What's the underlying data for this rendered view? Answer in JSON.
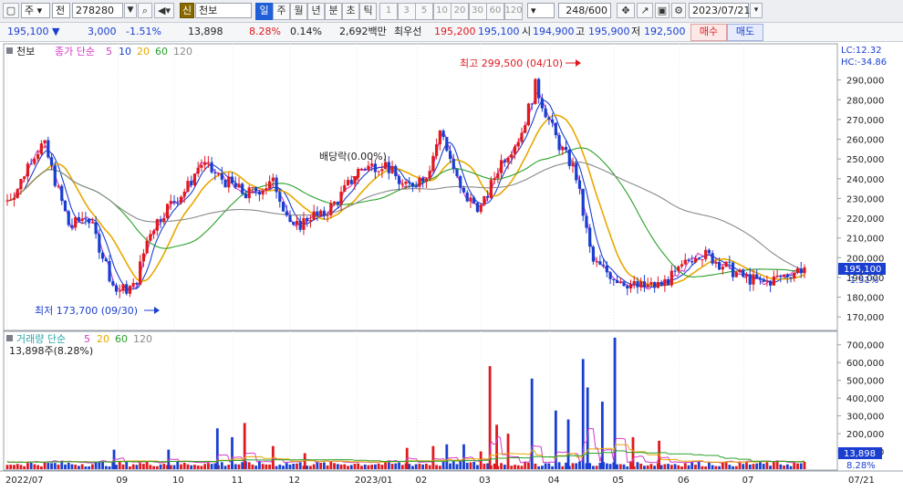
{
  "toolbar": {
    "market": "주",
    "type": "전",
    "code": "278280",
    "tag_new": "신",
    "name": "천보",
    "periods": [
      "일",
      "주",
      "월",
      "년",
      "분",
      "초",
      "틱"
    ],
    "intervals": [
      "1",
      "3",
      "5",
      "10",
      "20",
      "30",
      "60",
      "120"
    ],
    "count": "248/600",
    "date": "2023/07/21"
  },
  "info": {
    "price": "195,100",
    "change_arrow": "▼",
    "change": "3,000",
    "change_pct": "-1.51%",
    "volume": "13,898",
    "turnover": "8.28%",
    "pct2": "0.14%",
    "amount": "2,692백만",
    "prio_label": "최우선",
    "ask": "195,200",
    "bid": "195,100",
    "open_label": "시",
    "open": "194,900",
    "high_label": "고",
    "high": "195,900",
    "low_label": "저",
    "low": "192,500",
    "buy": "매수",
    "sell": "매도"
  },
  "price_panel": {
    "title": "천보",
    "indicator": "종가 단순",
    "ma": [
      "5",
      "10",
      "20",
      "60",
      "120"
    ],
    "lc": "LC:12.32",
    "hc": "HC:-34.86",
    "high_note": "최고 299,500 (04/10)",
    "low_note": "최저 173,700 (09/30)",
    "dividend_note": "배당락(0.00%)",
    "current_label": "195,100",
    "current_pct": "-1.51%",
    "yticks": [
      "290,000",
      "280,000",
      "270,000",
      "260,000",
      "250,000",
      "240,000",
      "230,000",
      "220,000",
      "210,000",
      "200,000",
      "190,000",
      "180,000",
      "170,000"
    ]
  },
  "volume_panel": {
    "title": "거래량 단순",
    "ma": [
      "5",
      "20",
      "60",
      "120"
    ],
    "summary": "13,898주(8.28%)",
    "yticks": [
      "700,000",
      "600,000",
      "500,000",
      "400,000",
      "300,000",
      "200,000",
      "100,000"
    ],
    "current_label": "13,898",
    "current_pct": "8.28%"
  },
  "xaxis": {
    "labels": [
      "2022/07",
      "09",
      "10",
      "11",
      "12",
      "2023/01",
      "02",
      "03",
      "04",
      "05",
      "06",
      "07"
    ],
    "last": "07/21"
  },
  "colors": {
    "up": "#e0191f",
    "down": "#1a3fd0",
    "ma5": "#d23cc8",
    "ma10": "#1a3fd0",
    "ma20": "#e8a800",
    "ma60": "#2aa02a",
    "ma120": "#8a8a8a"
  },
  "chart_data": {
    "type": "candlestick",
    "price_range": [
      165000,
      300000
    ],
    "volume_range": [
      0,
      750000
    ],
    "close_anchors": [
      [
        0,
        229000
      ],
      [
        10,
        236000
      ],
      [
        20,
        250000
      ],
      [
        32,
        258000
      ],
      [
        40,
        243000
      ],
      [
        55,
        215000
      ],
      [
        70,
        222000
      ],
      [
        85,
        200000
      ],
      [
        95,
        183000
      ],
      [
        112,
        185000
      ],
      [
        125,
        213000
      ],
      [
        140,
        225000
      ],
      [
        158,
        235000
      ],
      [
        170,
        248000
      ],
      [
        186,
        241000
      ],
      [
        210,
        232000
      ],
      [
        235,
        238000
      ],
      [
        252,
        214000
      ],
      [
        268,
        222000
      ],
      [
        275,
        220000
      ],
      [
        292,
        230000
      ],
      [
        310,
        245000
      ],
      [
        332,
        248000
      ],
      [
        350,
        235000
      ],
      [
        370,
        243000
      ],
      [
        382,
        265000
      ],
      [
        400,
        232000
      ],
      [
        418,
        225000
      ],
      [
        434,
        248000
      ],
      [
        452,
        262000
      ],
      [
        465,
        287000
      ],
      [
        485,
        258000
      ],
      [
        500,
        244000
      ],
      [
        515,
        198000
      ],
      [
        535,
        190000
      ],
      [
        555,
        185000
      ],
      [
        575,
        186000
      ],
      [
        590,
        192000
      ],
      [
        607,
        203000
      ],
      [
        620,
        200000
      ],
      [
        645,
        191000
      ],
      [
        665,
        187000
      ],
      [
        680,
        190000
      ],
      [
        702,
        195100
      ]
    ],
    "volume_spikes": [
      [
        118,
        110000
      ],
      [
        178,
        110000
      ],
      [
        232,
        230000
      ],
      [
        248,
        180000
      ],
      [
        262,
        260000
      ],
      [
        293,
        130000
      ],
      [
        328,
        90000
      ],
      [
        440,
        120000
      ],
      [
        470,
        130000
      ],
      [
        485,
        140000
      ],
      [
        503,
        140000
      ],
      [
        522,
        100000
      ],
      [
        532,
        580000
      ],
      [
        540,
        250000
      ],
      [
        552,
        200000
      ],
      [
        578,
        510000
      ],
      [
        604,
        330000
      ],
      [
        618,
        280000
      ],
      [
        635,
        620000
      ],
      [
        640,
        460000
      ],
      [
        656,
        380000
      ],
      [
        670,
        740000
      ],
      [
        690,
        180000
      ],
      [
        718,
        160000
      ]
    ]
  }
}
